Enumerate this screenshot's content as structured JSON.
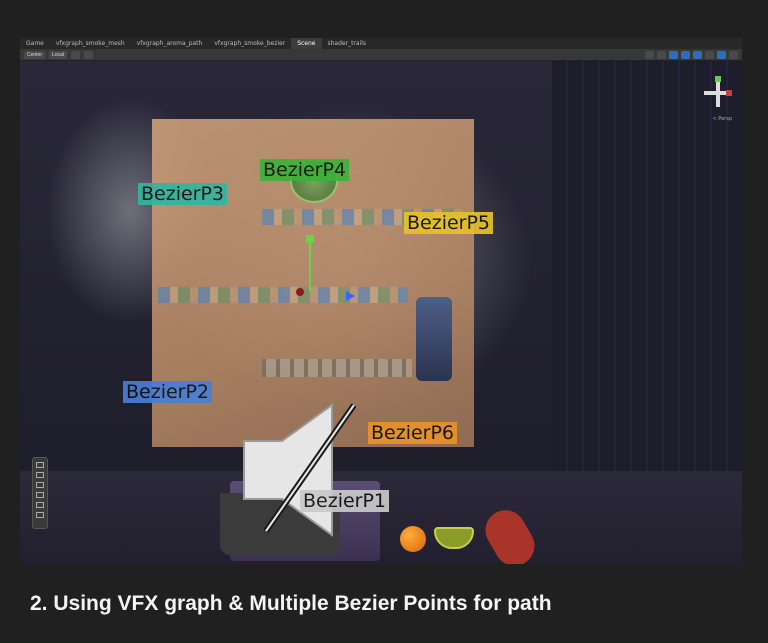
{
  "editor": {
    "tabs": [
      {
        "label": "Game"
      },
      {
        "label": "vfxgraph_smoke_mesh"
      },
      {
        "label": "vfxgraph_aroma_path"
      },
      {
        "label": "vfxgraph_smoke_bezier"
      },
      {
        "label": "Scene"
      },
      {
        "label": "shader_trails"
      }
    ],
    "active_tab": "Scene",
    "toolbar": {
      "center_label": "Center",
      "local_label": "Local"
    },
    "persp_label": "< Persp"
  },
  "scene": {
    "bezier_labels": {
      "p1": "BezierP1",
      "p2": "BezierP2",
      "p3": "BezierP3",
      "p4": "BezierP4",
      "p5": "BezierP5",
      "p6": "BezierP6"
    },
    "label_colors": {
      "p1": "#c9c9c9",
      "p2": "#4a7fd4",
      "p3": "#33b59e",
      "p4": "#3cb23a",
      "p5": "#e6c22a",
      "p6": "#e8932a"
    },
    "overlay_icon": "muted-speaker-icon"
  },
  "caption": "2. Using VFX graph & Multiple Bezier Points for path"
}
